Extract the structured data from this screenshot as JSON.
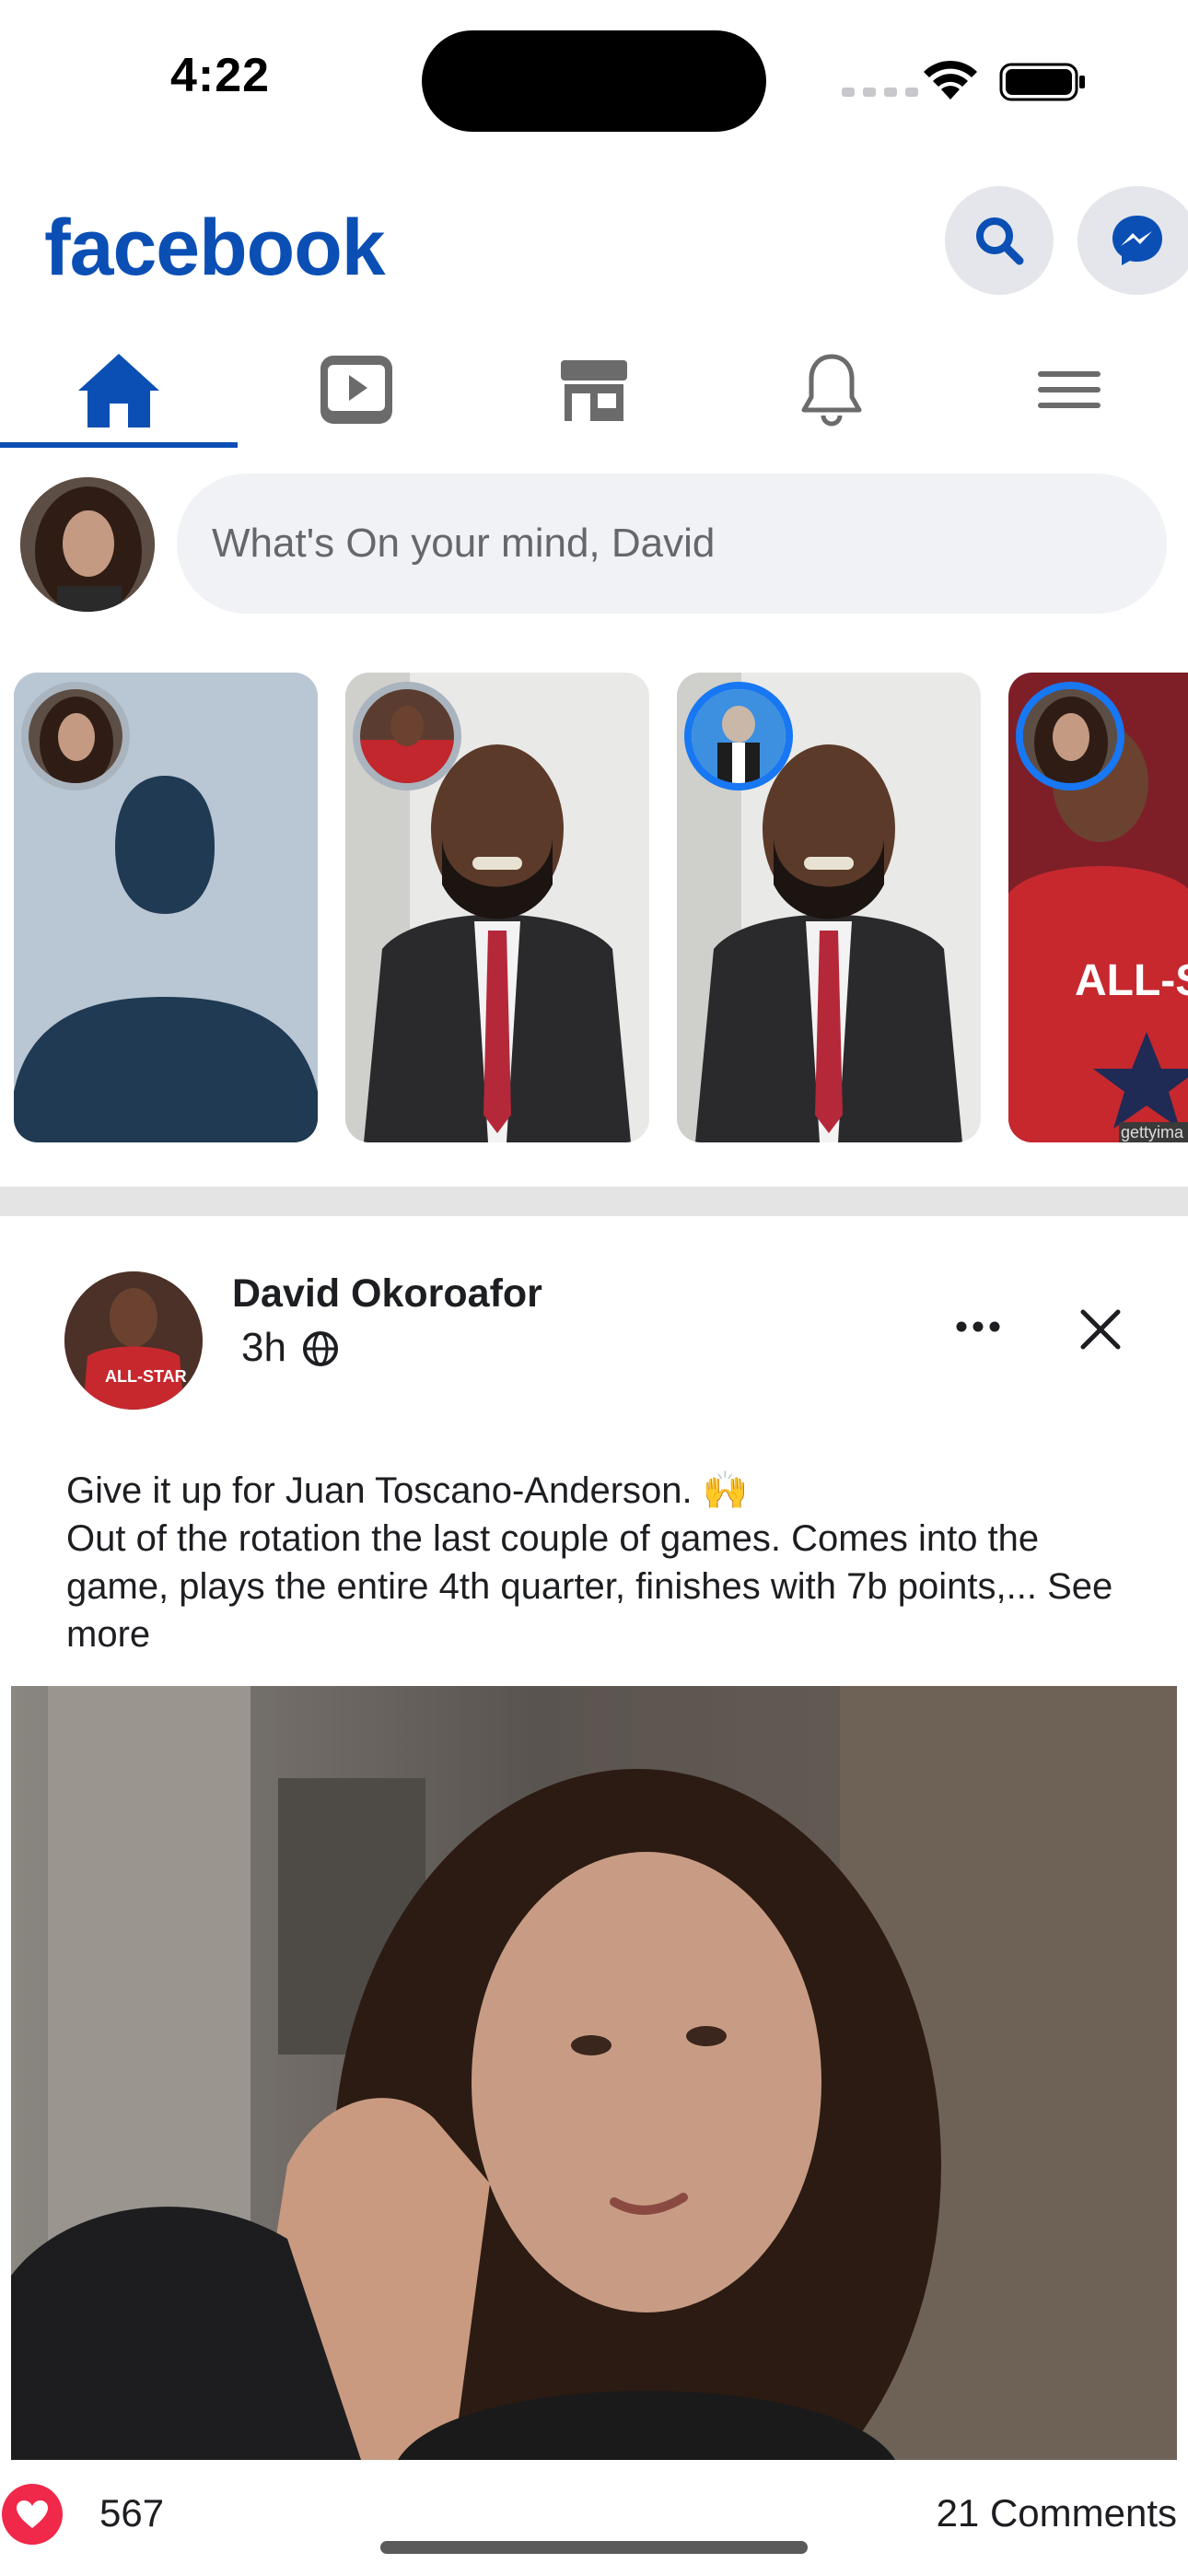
{
  "status_bar": {
    "time": "4:22"
  },
  "header": {
    "brand": "facebook",
    "brand_color": "#0b4fb5",
    "actions": [
      "search-icon",
      "messenger-icon"
    ]
  },
  "nav": {
    "tabs": [
      {
        "icon": "home-icon",
        "active": true
      },
      {
        "icon": "video-icon",
        "active": false
      },
      {
        "icon": "marketplace-icon",
        "active": false
      },
      {
        "icon": "bell-icon",
        "active": false
      },
      {
        "icon": "menu-icon",
        "active": false
      }
    ]
  },
  "composer": {
    "placeholder": "What's On your mind, David"
  },
  "stories": [
    {
      "type": "create",
      "ring": "gray"
    },
    {
      "type": "photo",
      "ring": "gray"
    },
    {
      "type": "photo",
      "ring": "blue"
    },
    {
      "type": "photo",
      "ring": "blue"
    }
  ],
  "post": {
    "author": "David Okoroafor",
    "time": "3h",
    "line1": "Give it up for Juan Toscano-Anderson. 🙌",
    "line2": "Out of the rotation the last couple of games. Comes into the game, plays the entire 4th quarter, finishes with 7b points,...",
    "see_more": "See more",
    "reactions": "567",
    "comments": "21 Comments"
  },
  "colors": {
    "accent": "#0b4fb5",
    "ring_blue": "#1877f2",
    "like_red": "#f02849"
  }
}
